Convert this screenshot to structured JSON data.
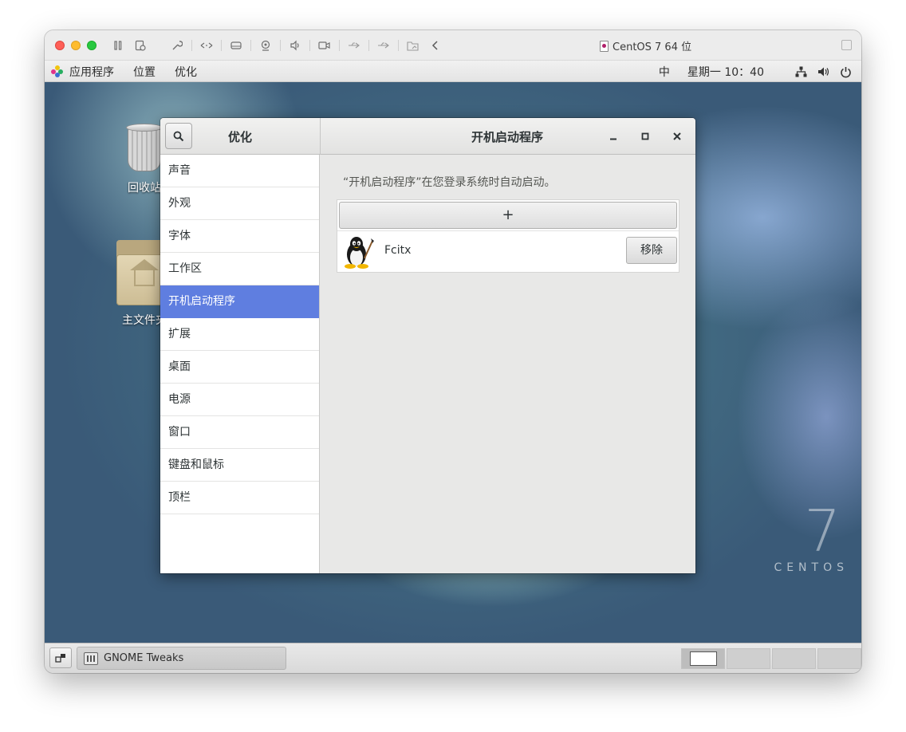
{
  "vm": {
    "title": "CentOS 7 64 位",
    "toolbar_icons": [
      "pause-icon",
      "snapshot-icon",
      "wrench-icon",
      "network-arrows-icon",
      "hard-disk-icon",
      "camera-icon",
      "speaker-icon",
      "video-camera-icon",
      "usb-icon",
      "usb-icon-2",
      "shared-folder-icon",
      "chevron-left-icon"
    ]
  },
  "gnome_topbar": {
    "menu": [
      "应用程序",
      "位置",
      "优化"
    ],
    "ime": "中",
    "clock": "星期一 10：40"
  },
  "desktop": {
    "icons": [
      {
        "label": "回收站"
      },
      {
        "label": "主文件夹"
      }
    ],
    "logo_number": "7",
    "logo_text": "CENTOS"
  },
  "tweaks": {
    "left_title": "优化",
    "right_title": "开机启动程序",
    "sidebar": [
      {
        "label": "声音",
        "active": false
      },
      {
        "label": "外观",
        "active": false
      },
      {
        "label": "字体",
        "active": false
      },
      {
        "label": "工作区",
        "active": false
      },
      {
        "label": "开机启动程序",
        "active": true
      },
      {
        "label": "扩展",
        "active": false
      },
      {
        "label": "桌面",
        "active": false
      },
      {
        "label": "电源",
        "active": false
      },
      {
        "label": "窗口",
        "active": false
      },
      {
        "label": "键盘和鼠标",
        "active": false
      },
      {
        "label": "顶栏",
        "active": false
      }
    ],
    "description": "“开机启动程序”在您登录系统时自动启动。",
    "add_label": "+",
    "apps": [
      {
        "name": "Fcitx",
        "remove_label": "移除"
      }
    ]
  },
  "taskbar": {
    "task_label": "GNOME Tweaks"
  },
  "colors": {
    "accent": "#5f7ee0",
    "tl_close": "#fe5f57",
    "tl_min": "#febc2e",
    "tl_max": "#28c840"
  }
}
